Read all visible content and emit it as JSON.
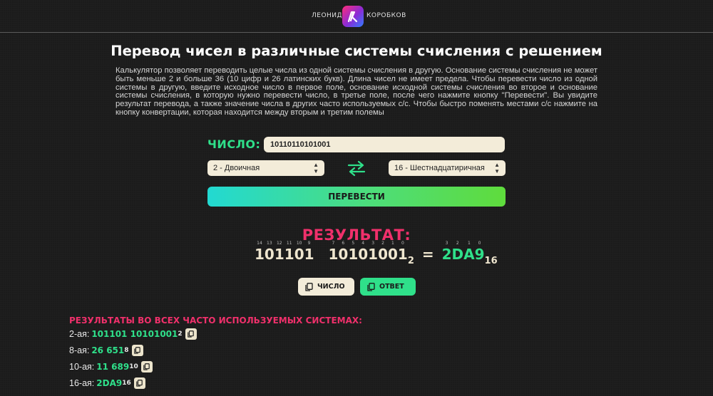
{
  "header": {
    "brand_first": "ЛЕОНИД",
    "brand_last": "КОРОБКОВ",
    "logo_text": "ЛК"
  },
  "page": {
    "title": "Перевод чисел в различные системы счисления с решением",
    "description": "Калькулятор позволяет переводить целые числа из одной системы счисления в другую. Основание системы счисления не может быть меньше 2 и больше 36 (10 цифр и 26 латинских букв). Длина чисел не имеет предела. Чтобы перевести число из одной системы в другую, введите исходное число в первое поле, основание исходной системы счисления во второе и основание системы счисления, в которую нужно перевести число, в третье поле, после чего нажмите кнопку \"Перевести\". Вы увидите результат перевода, а также значение числа в других часто используемых с/с. Чтобы быстро поменять местами с/с нажмите на кнопку конвертации, которая находится между вторым и третим полемы"
  },
  "form": {
    "number_label": "ЧИСЛО:",
    "number_value": "10110110101001",
    "from_base": "2 - Двоичная",
    "to_base": "16 - Шестнадцатиричная",
    "convert_label": "ПЕРЕВЕСТИ"
  },
  "result": {
    "title": "РЕЗУЛЬТАТ:",
    "source_groups": [
      {
        "digits": [
          "1",
          "0",
          "1",
          "1",
          "0",
          "1"
        ],
        "indices": [
          "14",
          "13",
          "12",
          "11",
          "10",
          "9"
        ]
      },
      {
        "digits": [
          "1",
          "0",
          "1",
          "0",
          "1",
          "0",
          "0",
          "1"
        ],
        "indices": [
          "7",
          "6",
          "5",
          "4",
          "3",
          "2",
          "1",
          "0"
        ]
      }
    ],
    "source_base": "2",
    "equals": "=",
    "answer_digits": [
      "2",
      "D",
      "A",
      "9"
    ],
    "answer_indices": [
      "3",
      "2",
      "1",
      "0"
    ],
    "answer_base": "16",
    "copy_number_label": "ЧИСЛО",
    "copy_answer_label": "ОТВЕТ"
  },
  "all_results": {
    "title": "РЕЗУЛЬТАТЫ ВО ВСЕХ ЧАСТО ИСПОЛЬЗУЕМЫХ СИСТЕМАХ:",
    "rows": [
      {
        "label": "2-ая:",
        "value": "101101 10101001",
        "base": "2"
      },
      {
        "label": "8-ая:",
        "value": "26 651",
        "base": "8"
      },
      {
        "label": "10-ая:",
        "value": "11 689",
        "base": "10"
      },
      {
        "label": "16-ая:",
        "value": "2DA9",
        "base": "16"
      }
    ]
  },
  "colors": {
    "accent_green": "#2fe08a",
    "accent_pink": "#f0306b",
    "field_bg": "#f3ecd9",
    "background": "#1b1b1b"
  },
  "icons": [
    "copy-icon",
    "swap-icon",
    "chevron-down-icon"
  ]
}
